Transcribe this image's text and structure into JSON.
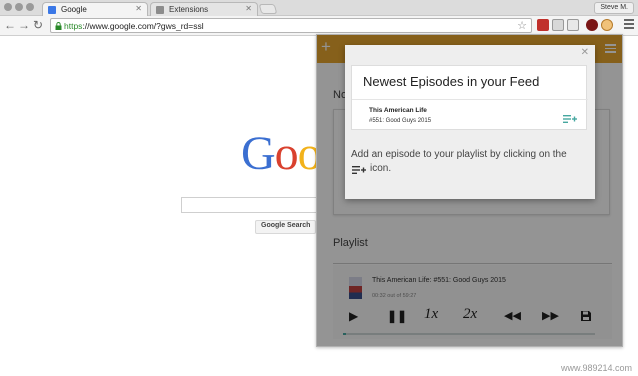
{
  "browser": {
    "tabs": [
      {
        "label": "Google",
        "active": true
      },
      {
        "label": "Extensions",
        "active": false
      }
    ],
    "user": "Steve M.",
    "url_secure": "https",
    "url_rest": "://www.google.com/?gws_rd=ssl",
    "extension_badge": "1"
  },
  "google": {
    "logo_letters": [
      {
        "char": "G",
        "color": "#3b6fd1"
      },
      {
        "char": "o",
        "color": "#d9412e"
      },
      {
        "char": "o",
        "color": "#f2b21b"
      }
    ],
    "search_button": "Google Search"
  },
  "popup": {
    "header_color": "#e7a52f",
    "section_label": "No",
    "playlist_label": "Playlist",
    "player": {
      "episode_title": "This American Life: #551: Good Guys 2015",
      "time": "00:32 out of 59:27",
      "controls": [
        "play",
        "pause",
        "1x",
        "2x",
        "rewind",
        "forward",
        "save"
      ],
      "speed_1": "1x",
      "speed_2": "2x",
      "progress": 0.01
    },
    "dialog": {
      "heading": "Newest Episodes in your Feed",
      "show": "This American Life",
      "episode": "#551: Good Guys 2015",
      "hint": "Add an episode to your playlist by clicking on the",
      "hint_end": "icon."
    },
    "accent": "#46a7a0"
  },
  "watermark": "www.989214.com"
}
